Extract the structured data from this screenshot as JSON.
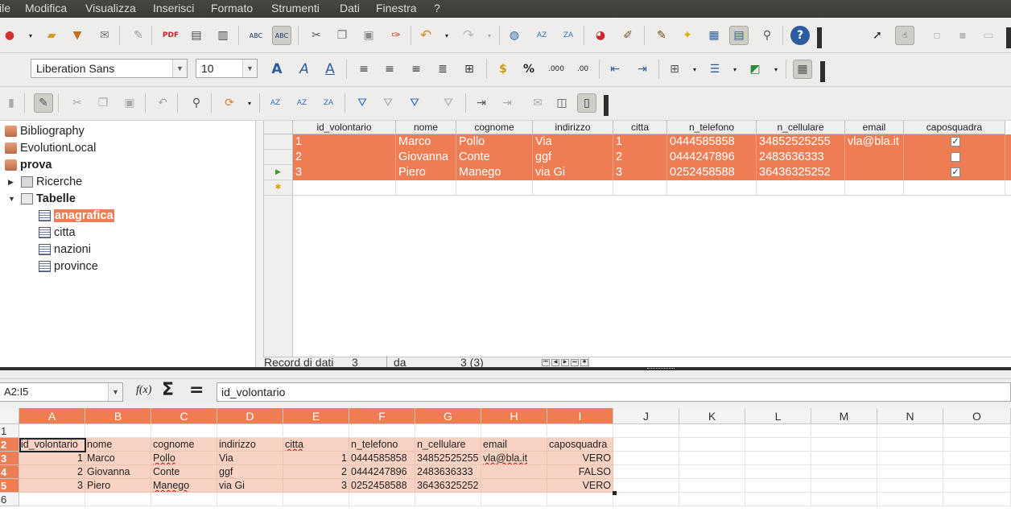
{
  "menubar": {
    "items": [
      "ile",
      "Modifica",
      "Visualizza",
      "Inserisci",
      "Formato",
      "Strumenti",
      "Dati",
      "Finestra",
      "?"
    ]
  },
  "font_toolbar": {
    "font_name": "Liberation Sans",
    "font_size": "10"
  },
  "tree": {
    "items": [
      {
        "label": "Bibliography",
        "bold": false,
        "selected": false
      },
      {
        "label": "EvolutionLocal",
        "bold": false,
        "selected": false
      },
      {
        "label": "prova",
        "bold": true,
        "selected": false
      },
      {
        "label": "Ricerche",
        "bold": false,
        "selected": false
      },
      {
        "label": "Tabelle",
        "bold": true,
        "selected": false
      },
      {
        "label": "anagrafica",
        "bold": true,
        "selected": true
      },
      {
        "label": "citta",
        "bold": false,
        "selected": false
      },
      {
        "label": "nazioni",
        "bold": false,
        "selected": false
      },
      {
        "label": "province",
        "bold": false,
        "selected": false
      }
    ]
  },
  "datagrid": {
    "columns": [
      "id_volontario",
      "nome",
      "cognome",
      "indirizzo",
      "citta",
      "n_telefono",
      "n_cellulare",
      "email",
      "caposquadra"
    ],
    "rows": [
      [
        "1",
        "Marco",
        "Pollo",
        "Via",
        "1",
        "0444585858",
        "34852525255",
        "vla@bla.it",
        "✓"
      ],
      [
        "2",
        "Giovanna",
        "Conte",
        "ggf",
        "2",
        "0444247896",
        "2483636333",
        "",
        ""
      ],
      [
        "3",
        "Piero",
        "Manego",
        "via Gi",
        "3",
        "0252458588",
        "36436325252",
        "",
        "✓"
      ]
    ],
    "selected_row_marker": "▶",
    "new_row_marker": "✱"
  },
  "record_bar": {
    "label": "Record di dati",
    "current": "3",
    "of_label": "da",
    "total": "3 (3)"
  },
  "formula_bar": {
    "name_box": "A2:I5",
    "fx": "f(x)",
    "sum": "Σ",
    "eq": "=",
    "content": "id_volontario"
  },
  "sheet": {
    "columns": [
      "A",
      "B",
      "C",
      "D",
      "E",
      "F",
      "G",
      "H",
      "I",
      "J",
      "K",
      "L",
      "M",
      "N",
      "O"
    ],
    "row_numbers": [
      "1",
      "2",
      "3",
      "4",
      "5",
      "6"
    ],
    "cells": [
      [
        "",
        "",
        "",
        "",
        "",
        "",
        "",
        "",
        ""
      ],
      [
        "id_volontario",
        "nome",
        "cognome",
        "indirizzo",
        "citta",
        "n_telefono",
        "n_cellulare",
        "email",
        "caposquadra"
      ],
      [
        "1",
        "Marco",
        "Pollo",
        "Via",
        "1",
        "0444585858",
        "34852525255",
        "vla@bla.it",
        "VERO"
      ],
      [
        "2",
        "Giovanna",
        "Conte",
        "ggf",
        "2",
        "0444247896",
        "2483636333",
        "",
        "FALSO"
      ],
      [
        "3",
        "Piero",
        "Manego",
        "via Gi",
        "3",
        "0252458588",
        "36436325252",
        "",
        "VERO"
      ],
      [
        "",
        "",
        "",
        "",
        "",
        "",
        "",
        "",
        ""
      ]
    ]
  },
  "colors": {
    "selection": "#ee7d54",
    "selection_light": "#f8d2c3",
    "menubar": "#3c3b37"
  }
}
